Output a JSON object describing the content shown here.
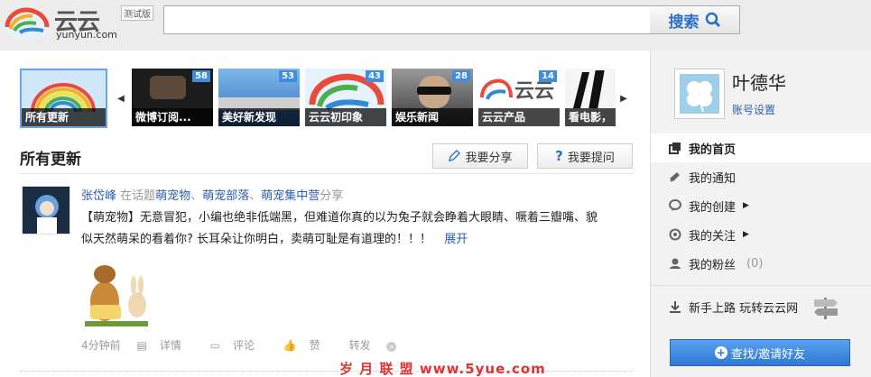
{
  "header": {
    "logo_text": "云云",
    "logo_sub": "yunyun.com",
    "beta_badge": "测试版",
    "search_value": "",
    "search_button": "搜索"
  },
  "strip": {
    "first": {
      "label": "所有更新"
    },
    "items": [
      {
        "label": "微博订阅...",
        "count": "58",
        "bg": "#1c1c1c"
      },
      {
        "label": "美好新发现",
        "count": "53",
        "bg": "#4d8fcf"
      },
      {
        "label": "云云初印象",
        "count": "43",
        "bg": "#2f8ad8"
      },
      {
        "label": "娱乐新闻",
        "count": "28",
        "bg": "#6e6e6e"
      },
      {
        "label": "云云产品",
        "count": "14",
        "bg": "#ffffff"
      },
      {
        "label": "看电影，",
        "count": "",
        "bg": "#f5f5f5"
      }
    ]
  },
  "feed": {
    "title": "所有更新",
    "share_button": "我要分享",
    "ask_button": "我要提问"
  },
  "post": {
    "author": "张岱峰",
    "meta_prefix": " 在话题",
    "topics": [
      "萌宠物",
      "萌宠部落",
      "萌宠集中营"
    ],
    "topic_sep": "、",
    "meta_suffix": "分享",
    "text": "【萌宠物】无意冒犯，小编也绝非低端黑，但难道你真的以为兔子就会睁着大眼睛、噘着三瓣嘴、貌似天然萌呆的看着你? 长耳朵让你明白，卖萌可耻是有道理的！！！",
    "expand": "展开",
    "time": "4分钟前",
    "detail": "详情",
    "comment": "评论",
    "like": "赞",
    "forward": "转发"
  },
  "watermark": "岁 月 联 盟 www.5yue.com",
  "sidebar": {
    "name": "叶德华",
    "settings": "账号设置",
    "nav": [
      {
        "label": "我的首页",
        "icon": "home-icon"
      },
      {
        "label": "我的通知",
        "icon": "horn-icon"
      },
      {
        "label": "我的创建",
        "icon": "bubble-icon"
      },
      {
        "label": "我的关注",
        "icon": "follow-icon"
      },
      {
        "label": "我的粉丝",
        "icon": "fans-icon",
        "count": "(0)"
      }
    ],
    "guide": "新手上路 玩转云云网",
    "invite": "查找/邀请好友"
  },
  "colors": {
    "accent": "#2f77d4",
    "link": "#2a5db0",
    "badge": "#3d8de0"
  }
}
